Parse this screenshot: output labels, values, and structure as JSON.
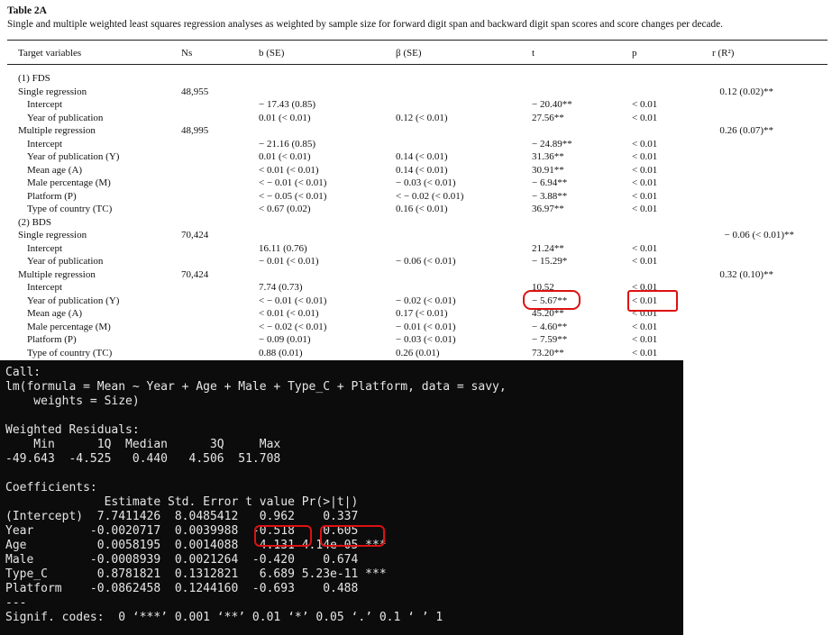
{
  "table": {
    "title": "Table 2A",
    "caption": "Single and multiple weighted least squares regression analyses as weighted by sample size for forward digit span and backward digit span scores and score changes per decade.",
    "headers": [
      "Target variables",
      "Ns",
      "b (SE)",
      "β (SE)",
      "t",
      "p",
      "r (R²)"
    ],
    "rows": [
      {
        "label": "(1) FDS",
        "ns": "",
        "b": "",
        "beta": "",
        "t": "",
        "p": "",
        "r": ""
      },
      {
        "label": "Single regression",
        "ns": "48,955",
        "b": "",
        "beta": "",
        "t": "",
        "p": "",
        "r": "0.12 (0.02)**"
      },
      {
        "label": "Intercept",
        "ns": "",
        "b": "− 17.43 (0.85)",
        "beta": "",
        "t": "− 20.40**",
        "p": "< 0.01",
        "r": ""
      },
      {
        "label": "Year of publication",
        "ns": "",
        "b": "0.01 (< 0.01)",
        "beta": "0.12 (< 0.01)",
        "t": "27.56**",
        "p": "< 0.01",
        "r": ""
      },
      {
        "label": "Multiple regression",
        "ns": "48,995",
        "b": "",
        "beta": "",
        "t": "",
        "p": "",
        "r": "0.26 (0.07)**"
      },
      {
        "label": "Intercept",
        "ns": "",
        "b": "− 21.16 (0.85)",
        "beta": "",
        "t": "− 24.89**",
        "p": "< 0.01",
        "r": ""
      },
      {
        "label": "Year of publication (Y)",
        "ns": "",
        "b": "0.01 (< 0.01)",
        "beta": "0.14 (< 0.01)",
        "t": "31.36**",
        "p": "< 0.01",
        "r": ""
      },
      {
        "label": "Mean age (A)",
        "ns": "",
        "b": "< 0.01 (< 0.01)",
        "beta": "0.14 (< 0.01)",
        "t": "30.91**",
        "p": "< 0.01",
        "r": ""
      },
      {
        "label": "Male percentage (M)",
        "ns": "",
        "b": "< − 0.01 (< 0.01)",
        "beta": "− 0.03 (< 0.01)",
        "t": "− 6.94**",
        "p": "< 0.01",
        "r": ""
      },
      {
        "label": "Platform (P)",
        "ns": "",
        "b": "< − 0.05 (< 0.01)",
        "beta": "< − 0.02 (< 0.01)",
        "t": "− 3.88**",
        "p": "< 0.01",
        "r": ""
      },
      {
        "label": "Type of country (TC)",
        "ns": "",
        "b": "< 0.67 (0.02)",
        "beta": "0.16 (< 0.01)",
        "t": "36.97**",
        "p": "< 0.01",
        "r": ""
      },
      {
        "label": "(2) BDS",
        "ns": "",
        "b": "",
        "beta": "",
        "t": "",
        "p": "",
        "r": ""
      },
      {
        "label": "Single regression",
        "ns": "70,424",
        "b": "",
        "beta": "",
        "t": "",
        "p": "",
        "r": "− 0.06 (< 0.01)**"
      },
      {
        "label": "Intercept",
        "ns": "",
        "b": "16.11 (0.76)",
        "beta": "",
        "t": "21.24**",
        "p": "< 0.01",
        "r": ""
      },
      {
        "label": "Year of publication",
        "ns": "",
        "b": "− 0.01 (< 0.01)",
        "beta": "− 0.06 (< 0.01)",
        "t": "− 15.29*",
        "p": "< 0.01",
        "r": ""
      },
      {
        "label": "Multiple regression",
        "ns": "70,424",
        "b": "",
        "beta": "",
        "t": "",
        "p": "",
        "r": "0.32 (0.10)**"
      },
      {
        "label": "Intercept",
        "ns": "",
        "b": "7.74 (0.73)",
        "beta": "",
        "t": "10.52",
        "p": "< 0.01",
        "r": ""
      },
      {
        "label": "Year of publication (Y)",
        "ns": "",
        "b": "< − 0.01 (< 0.01)",
        "beta": "− 0.02 (< 0.01)",
        "t": "− 5.67**",
        "p": "< 0.01",
        "r": ""
      },
      {
        "label": "Mean age (A)",
        "ns": "",
        "b": "< 0.01 (< 0.01)",
        "beta": "0.17 (< 0.01)",
        "t": "45.20**",
        "p": "< 0.01",
        "r": ""
      },
      {
        "label": "Male percentage (M)",
        "ns": "",
        "b": "< − 0.02 (< 0.01)",
        "beta": "− 0.01 (< 0.01)",
        "t": "− 4.60**",
        "p": "< 0.01",
        "r": ""
      },
      {
        "label": "Platform (P)",
        "ns": "",
        "b": "− 0.09 (0.01)",
        "beta": "− 0.03 (< 0.01)",
        "t": "− 7.59**",
        "p": "< 0.01",
        "r": ""
      },
      {
        "label": "Type of country (TC)",
        "ns": "",
        "b": "0.88 (0.01)",
        "beta": "0.26 (0.01)",
        "t": "73.20**",
        "p": "< 0.01",
        "r": ""
      }
    ]
  },
  "console": {
    "lines": [
      "Call:",
      "lm(formula = Mean ~ Year + Age + Male + Type_C + Platform, data = savy,",
      "    weights = Size)",
      "",
      "Weighted Residuals:",
      "    Min      1Q  Median      3Q     Max ",
      "-49.643  -4.525   0.440   4.506  51.708 ",
      "",
      "Coefficients:",
      "              Estimate Std. Error t value Pr(>|t|)    ",
      "(Intercept)  7.7411426  8.0485412   0.962    0.337    ",
      "Year        -0.0020717  0.0039988  -0.518    0.605    ",
      "Age          0.0058195  0.0014088   4.131 4.14e-05 ***",
      "Male        -0.0008939  0.0021264  -0.420    0.674    ",
      "Type_C       0.8781821  0.1312821   6.689 5.23e-11 ***",
      "Platform    -0.0862458  0.1244160  -0.693    0.488    ",
      "---",
      "Signif. codes:  0 ‘***’ 0.001 ‘**’ 0.01 ‘*’ 0.05 ‘.’ 0.1 ‘ ’ 1"
    ]
  },
  "colors": {
    "terminal_bg": "#0c0c0c",
    "terminal_text": "#e6e6e6",
    "annotation": "#dd1111"
  }
}
